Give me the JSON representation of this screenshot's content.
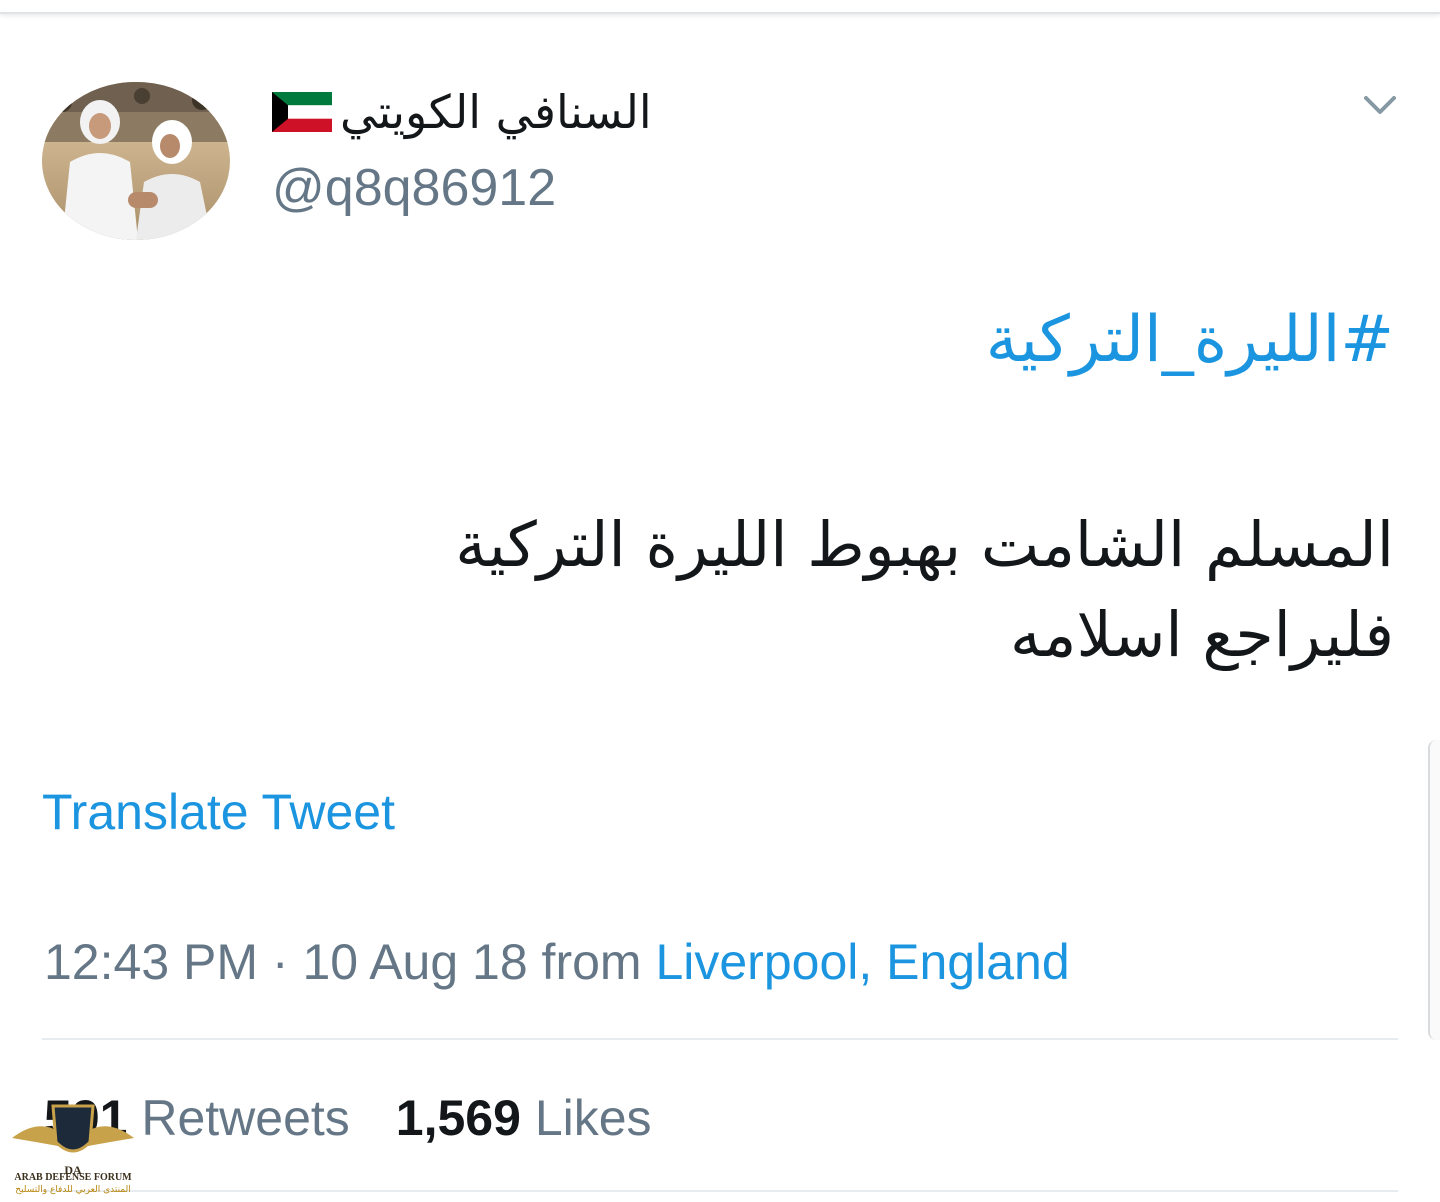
{
  "tweet": {
    "display_name": "السنافي الكويتي",
    "handle": "@q8q86912",
    "hashtag": "#الليرة_التركية",
    "text_line1": "المسلم الشامت بهبوط الليرة التركية",
    "text_line2": "فليراجع اسلامه",
    "translate_label": "Translate Tweet",
    "time": "12:43 PM · 10 Aug 18 from ",
    "location": "Liverpool, England",
    "retweets_count": "591",
    "retweets_label": "Retweets",
    "likes_count": "1,569",
    "likes_label": "Likes",
    "flag_icon": "kuwait-flag-icon",
    "menu_icon": "chevron-down-icon"
  },
  "watermark": {
    "title": "ARAB DEFENSE FORUM",
    "subtitle": "المنتدى العربي للدفاع والتسليح"
  },
  "colors": {
    "link": "#1b95e0",
    "secondary": "#657786",
    "primary": "#14171a"
  }
}
